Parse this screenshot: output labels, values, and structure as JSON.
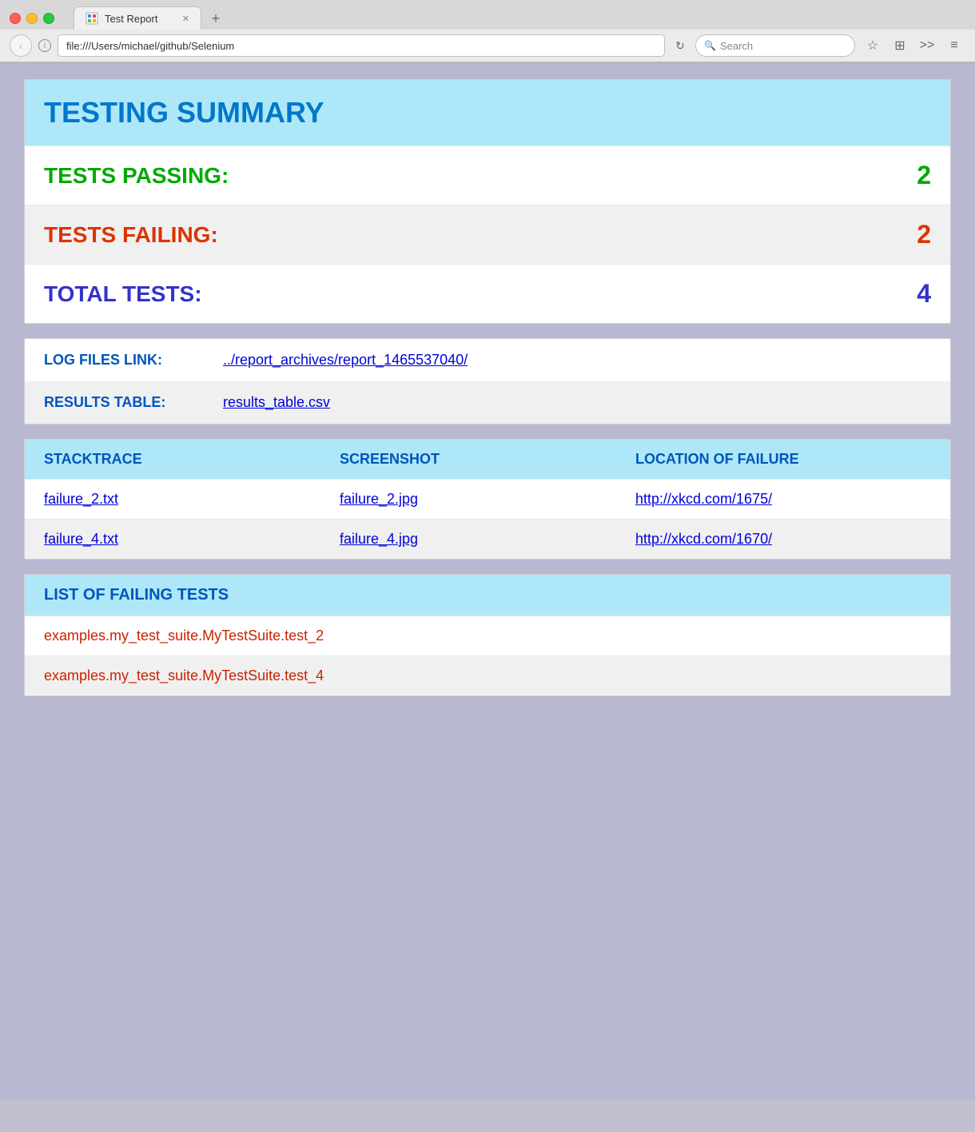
{
  "browser": {
    "url": "file:///Users/michael/github/Selenium",
    "tab_title": "Test Report",
    "search_placeholder": "Search",
    "tab_new_label": "+"
  },
  "summary": {
    "title": "TESTING SUMMARY",
    "passing_label": "TESTS PASSING:",
    "passing_value": "2",
    "failing_label": "TESTS FAILING:",
    "failing_value": "2",
    "total_label": "TOTAL TESTS:",
    "total_value": "4"
  },
  "links": {
    "log_files_label": "LOG FILES LINK:",
    "log_files_url": "../report_archives/report_1465537040/",
    "results_label": "RESULTS TABLE:",
    "results_url": "results_table.csv"
  },
  "failures_table": {
    "col1": "STACKTRACE",
    "col2": "SCREENSHOT",
    "col3": "LOCATION OF FAILURE",
    "rows": [
      {
        "stacktrace": "failure_2.txt",
        "screenshot": "failure_2.jpg",
        "location": "http://xkcd.com/1675/"
      },
      {
        "stacktrace": "failure_4.txt",
        "screenshot": "failure_4.jpg",
        "location": "http://xkcd.com/1670/"
      }
    ]
  },
  "failing_list": {
    "header": "LIST OF FAILING TESTS",
    "tests": [
      "examples.my_test_suite.MyTestSuite.test_2",
      "examples.my_test_suite.MyTestSuite.test_4"
    ]
  }
}
